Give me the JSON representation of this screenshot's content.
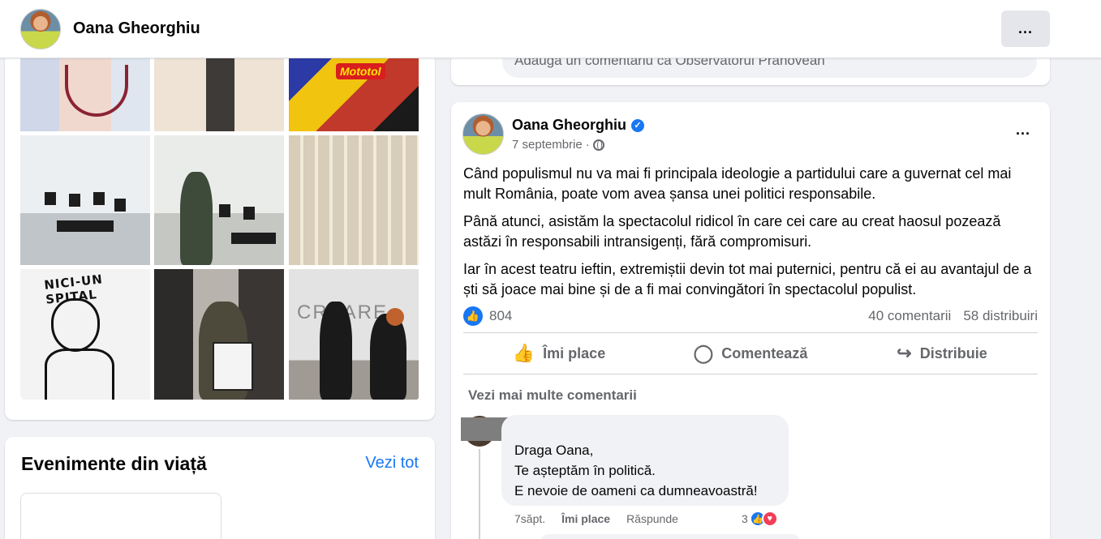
{
  "header": {
    "name": "Oana Gheorghiu",
    "more_label": "..."
  },
  "photos": {
    "tile3_brand": "Mototol",
    "tile7_text": "NICI-UN SPITAL",
    "tile9_text": "CREARE"
  },
  "events": {
    "title": "Evenimente din viață",
    "see_all": "Vezi tot"
  },
  "previous_post": {
    "comment_placeholder": "Adaugă un comentariu ca Observatorul Prahovean"
  },
  "post": {
    "author": "Oana Gheorghiu",
    "date": "7 septembrie",
    "separator": "·",
    "more_label": "...",
    "paragraphs": [
      "Când populismul nu va mai fi principala ideologie a partidului care a guvernat cel mai mult România, poate vom avea șansa unei politici responsabile.",
      "Până atunci, asistăm la spectacolul ridicol în care cei care au creat haosul pozează astăzi în responsabili intransigenți, fără compromisuri.",
      "Iar în acest teatru ieftin, extremiștii devin tot mai puternici, pentru că ei au avantajul de a ști să joace mai bine și de a fi mai convingători în spectacolul populist."
    ],
    "reactions_count": "804",
    "comments_count": "40 comentarii",
    "shares_count": "58 distribuiri",
    "actions": {
      "like": "Îmi place",
      "comment": "Comentează",
      "share": "Distribuie"
    },
    "more_comments": "Vezi mai multe comentarii",
    "comment": {
      "lines": [
        "Draga Oana,",
        "Te așteptăm în politică.",
        "E nevoie de oameni ca dumneavoastră!"
      ],
      "time": "7săpt.",
      "like": "Îmi place",
      "reply": "Răspunde",
      "reactions": "3"
    }
  },
  "colors": {
    "accent": "#1877f2",
    "background": "#f0f2f5",
    "secondary_text": "#65676b"
  }
}
